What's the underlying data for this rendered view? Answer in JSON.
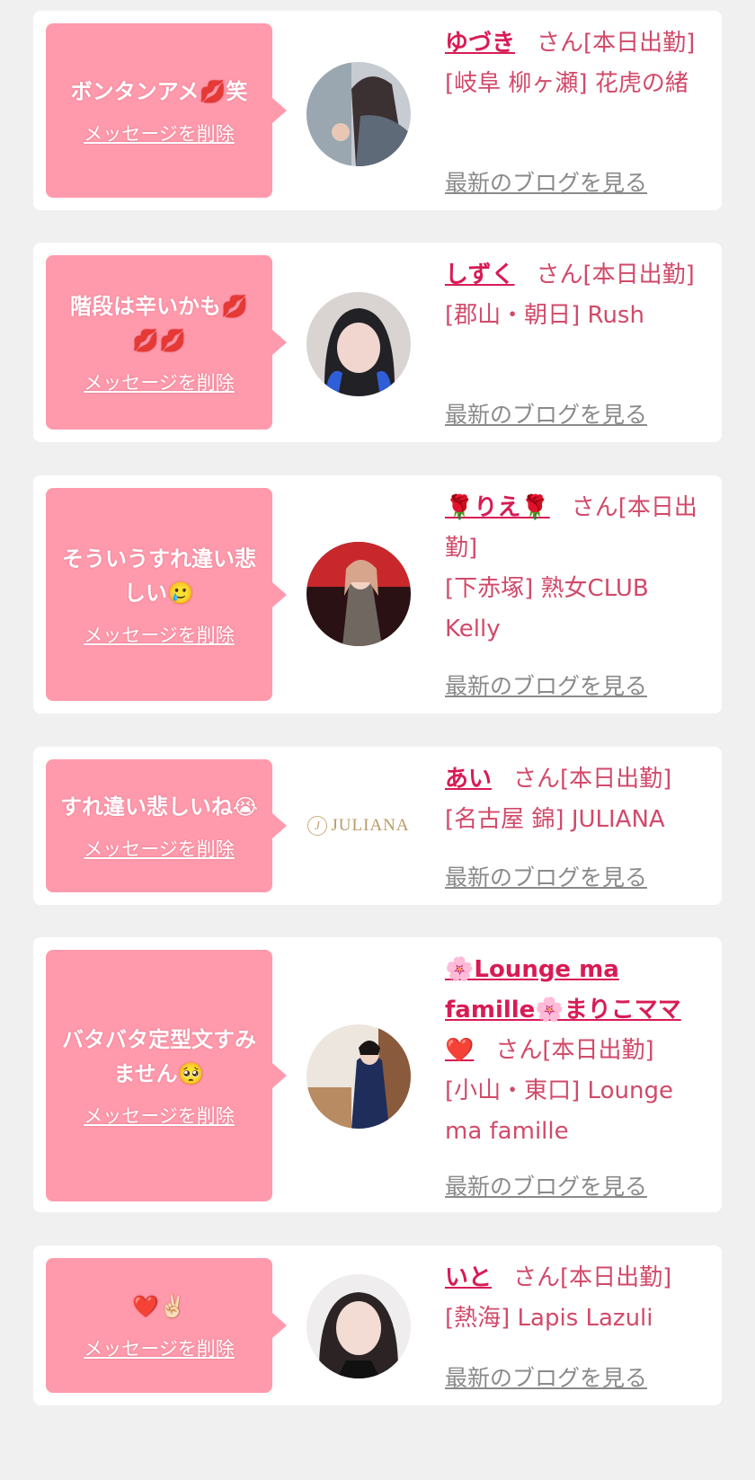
{
  "entries": [
    {
      "message": "ボンタンアメ💋笑",
      "delete_label": "メッセージを削除",
      "name": "ゆづき",
      "status": "さん[本日出勤]",
      "area_shop": "[岐阜 柳ヶ瀬] 花虎の緒",
      "blog_label": "最新のブログを見る"
    },
    {
      "message": "階段は辛いかも💋💋💋",
      "delete_label": "メッセージを削除",
      "name": "しずく",
      "status": "さん[本日出勤]",
      "area_shop": "[郡山・朝日] Rush",
      "blog_label": "最新のブログを見る"
    },
    {
      "message": "そういうすれ違い悲しい🥲",
      "delete_label": "メッセージを削除",
      "name": "🌹りえ🌹",
      "status": "さん[本日出勤]",
      "area_shop": "[下赤塚] 熟女CLUB Kelly",
      "blog_label": "最新のブログを見る"
    },
    {
      "message": "すれ違い悲しいね😭",
      "delete_label": "メッセージを削除",
      "name": "あい",
      "status": "さん[本日出勤]",
      "area_shop": "[名古屋 錦] JULIANA",
      "logo_text": "JULIANA",
      "logo_mark": "J",
      "blog_label": "最新のブログを見る"
    },
    {
      "message": "バタバタ定型文すみません🥺",
      "delete_label": "メッセージを削除",
      "name": "🌸Lounge ma famille🌸まりこママ❤️",
      "status": "さん[本日出勤]",
      "area_shop": "[小山・東口] Lounge ma famille",
      "blog_label": "最新のブログを見る"
    },
    {
      "message": "❤️✌🏻",
      "delete_label": "メッセージを削除",
      "name": "いと",
      "status": "さん[本日出勤]",
      "area_shop": "[熱海] Lapis Lazuli",
      "blog_label": "最新のブログを見る"
    }
  ],
  "colors": {
    "page_bg": "#f0f0f0",
    "bubble": "#ff9aac",
    "name": "#d81b55",
    "info_text": "#d14a6a",
    "blog_link": "#8a8a8a"
  }
}
